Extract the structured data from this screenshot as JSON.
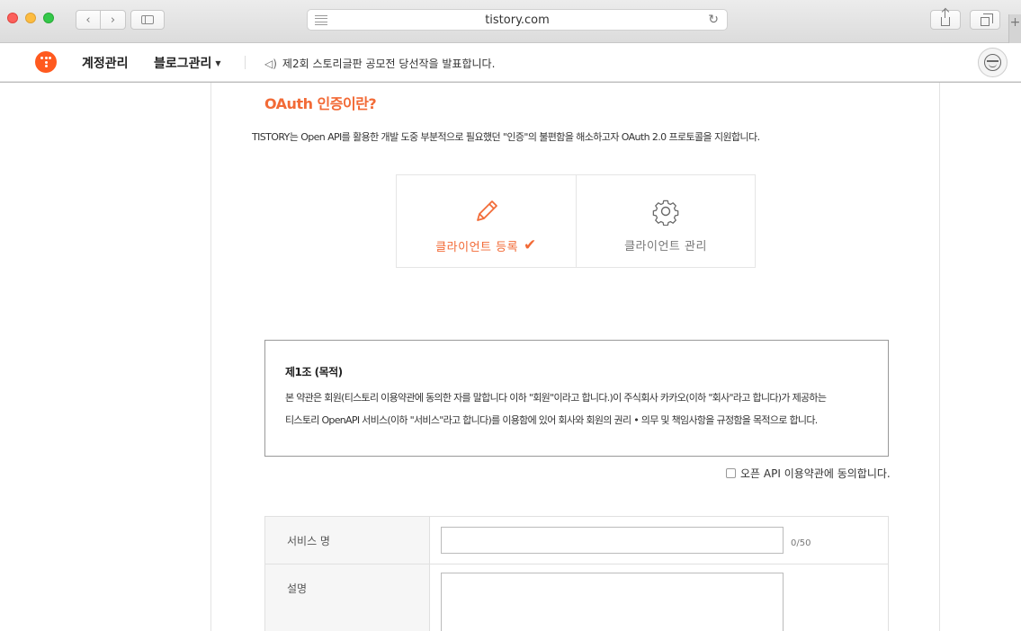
{
  "browser": {
    "url": "tistory.com",
    "reload_glyph": "↻",
    "back_glyph": "‹",
    "forward_glyph": "›",
    "newtab_glyph": "+"
  },
  "nav": {
    "account": "계정관리",
    "blog": "블로그관리",
    "blog_caret": "▼",
    "speaker_glyph": "◁)",
    "notice": "제2회 스토리글판 공모전 당선작을 발표합니다."
  },
  "oauth": {
    "title": "OAuth 인증이란?",
    "description": "TISTORY는 Open API를 활용한 개발 도중 부분적으로 필요했던 \"인증\"의 불편함을 해소하고자 OAuth 2.0 프로토콜을 지원합니다."
  },
  "steps": [
    {
      "label": "클라이언트 등록",
      "icon": "pencil-icon",
      "check_glyph": "✔"
    },
    {
      "label": "클라이언트 관리",
      "icon": "gear-icon"
    }
  ],
  "terms": {
    "heading": "제1조 (목적)",
    "line1": "본 약관은 회원(티스토리 이용약관에 동의한 자를 말합니다 이하 \"회원\"이라고 합니다.)이 주식회사 카카오(이하 \"회사\"라고 합니다)가 제공하는",
    "line2": "티스토리 OpenAPI 서비스(이하 \"서비스\"라고 합니다)를 이용함에 있어 회사와 회원의 권리 • 의무 및 책임사항을 규정함을 목적으로 합니다."
  },
  "agree_label": "오픈 API 이용약관에 동의합니다.",
  "form": {
    "service_name_label": "서비스 명",
    "service_name_value": "",
    "service_name_counter": "0/50",
    "description_label": "설명",
    "description_value": ""
  },
  "colors": {
    "accent": "#f26a36",
    "logo": "#ff5a1f"
  }
}
